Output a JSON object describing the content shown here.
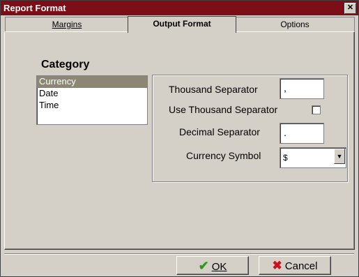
{
  "window": {
    "title": "Report Format",
    "close_glyph": "✕"
  },
  "tabs": [
    {
      "label": "Margins",
      "active": false
    },
    {
      "label": "Output Format",
      "active": true
    },
    {
      "label": "Options",
      "active": false
    }
  ],
  "category": {
    "label": "Category",
    "items": [
      "Currency",
      "Date",
      "Time"
    ],
    "selected": "Currency"
  },
  "fields": {
    "thousand_separator": {
      "label": "Thousand Separator",
      "value": ","
    },
    "use_thousand_separator": {
      "label": "Use Thousand Separator",
      "checked": false
    },
    "decimal_separator": {
      "label": "Decimal Separator",
      "value": "."
    },
    "currency_symbol": {
      "label": "Currency Symbol",
      "value": "$"
    }
  },
  "buttons": {
    "ok": {
      "label": "OK",
      "icon": "checkmark-icon"
    },
    "cancel": {
      "label": "Cancel",
      "icon": "x-icon"
    }
  },
  "colors": {
    "titlebar": "#7b0e16",
    "selection": "#8c8772",
    "ok_icon": "#2e9a1a",
    "cancel_icon": "#c8121d"
  }
}
